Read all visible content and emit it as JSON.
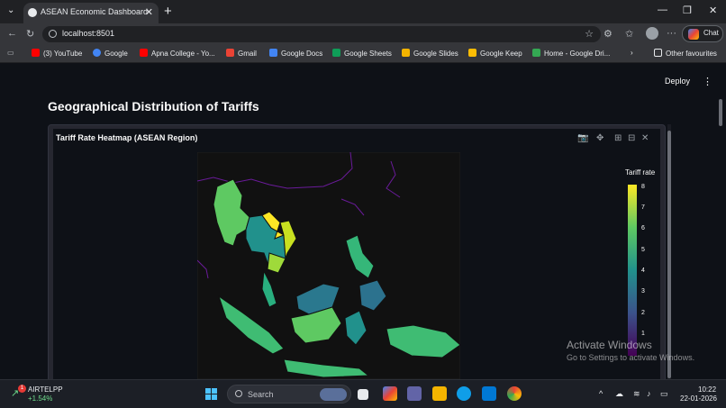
{
  "browser": {
    "tab_title": "ASEAN Economic Dashboard",
    "new_tab": "+",
    "tab_close": "✕",
    "url": "localhost:8501",
    "chat_label": "Chat",
    "window_controls": {
      "minimize": "—",
      "restore": "❐",
      "close": "✕"
    },
    "toolbar_more": "···",
    "bookmarks": [
      {
        "label": "(3) YouTube",
        "color": "#ff0000"
      },
      {
        "label": "Google",
        "color": "#4285f4"
      },
      {
        "label": "Apna College - Yo...",
        "color": "#ff0000"
      },
      {
        "label": "Gmail",
        "color": "#ea4335"
      },
      {
        "label": "Google Docs",
        "color": "#4285f4"
      },
      {
        "label": "Google Sheets",
        "color": "#0f9d58"
      },
      {
        "label": "Google Slides",
        "color": "#f4b400"
      },
      {
        "label": "Google Keep",
        "color": "#fbbc04"
      },
      {
        "label": "Home - Google Dri...",
        "color": "#34a853"
      }
    ],
    "bookmarks_more": "›",
    "other_favourites": "Other favourites"
  },
  "app": {
    "deploy_label": "Deploy",
    "menu_label": "⋮",
    "section_title": "Geographical Distribution of Tariffs"
  },
  "chart": {
    "title": "Tariff Rate Heatmap (ASEAN Region)",
    "colorbar_title": "Tariff rate",
    "colorbar_ticks": [
      "8",
      "7",
      "6",
      "5",
      "4",
      "3",
      "2",
      "1"
    ],
    "modebar_icons": [
      "camera-icon",
      "pan-icon",
      "zoom-in-icon",
      "zoom-out-icon",
      "reset-icon"
    ]
  },
  "chart_data": {
    "type": "heatmap",
    "title": "Tariff Rate Heatmap (ASEAN Region)",
    "colorbar_title": "Tariff rate",
    "colorscale": "viridis",
    "range": [
      0,
      8
    ],
    "colors": {
      "low": "#440154",
      "mid": "#21918c",
      "high": "#fde725"
    }
  },
  "watermark": {
    "line1": "Activate Windows",
    "line2": "Go to Settings to activate Windows."
  },
  "taskbar": {
    "stock_name": "AIRTELPP",
    "stock_change": "+1.54%",
    "stock_badge": "1",
    "search_placeholder": "Search",
    "time": "10:22",
    "date": "22-01-2026"
  }
}
